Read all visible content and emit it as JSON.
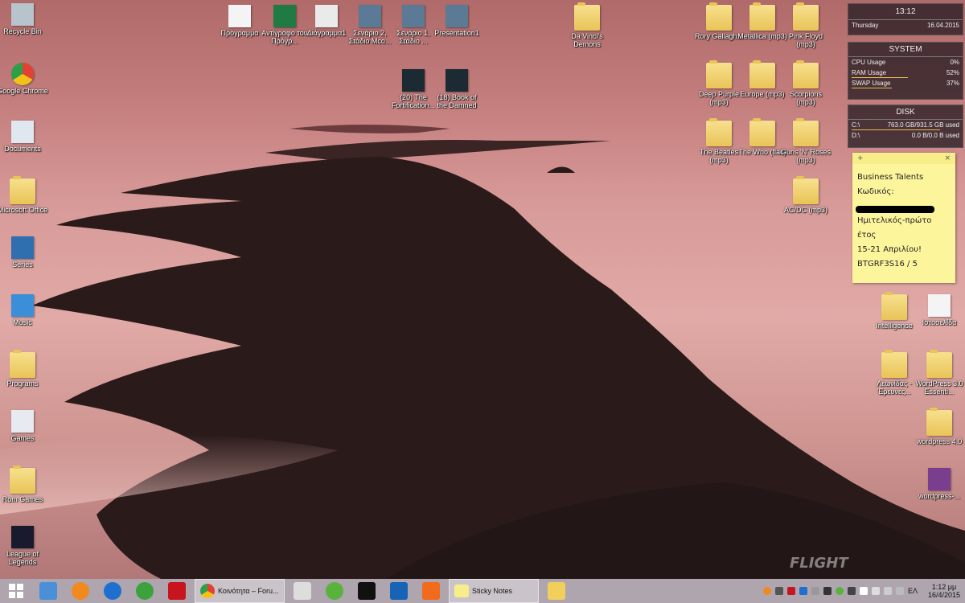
{
  "desktop": {
    "left_column": [
      {
        "label": "Recycle Bin",
        "icon": "recycle-bin-icon"
      },
      {
        "label": "Google Chrome",
        "icon": "chrome-icon"
      },
      {
        "label": "Documents",
        "icon": "documents-icon"
      },
      {
        "label": "Microsoft Office",
        "icon": "folder-icon"
      },
      {
        "label": "Series",
        "icon": "series-icon"
      },
      {
        "label": "Music",
        "icon": "music-icon"
      },
      {
        "label": "Programs",
        "icon": "folder-icon"
      },
      {
        "label": "Games",
        "icon": "games-icon"
      },
      {
        "label": "Rom Games",
        "icon": "folder-icon"
      },
      {
        "label": "League of Legends",
        "icon": "league-icon"
      }
    ],
    "top_row": [
      {
        "label": "Πρόγραμμα",
        "icon": "pdf-icon"
      },
      {
        "label": "Αντίγραφο του Πρόγρ...",
        "icon": "excel-icon"
      },
      {
        "label": "Διάγραμμα1",
        "icon": "diagram-icon"
      },
      {
        "label": "Σενάριο 2, Στάδιο Mco...",
        "icon": "powerpoint-icon"
      },
      {
        "label": "Σενάριο 1, Στάδιο ...",
        "icon": "powerpoint-icon"
      },
      {
        "label": "Presentation1",
        "icon": "powerpoint-icon"
      },
      {
        "label": "(20) The Fortification...",
        "icon": "video-icon"
      },
      {
        "label": "(18) Book of the Damned",
        "icon": "video-icon"
      },
      {
        "label": "Da Vinci's Demons",
        "icon": "folder-icon"
      }
    ],
    "right_icons": [
      {
        "label": "Rory Gallagh...",
        "icon": "folder-icon"
      },
      {
        "label": "Metallica (mp3)",
        "icon": "folder-icon"
      },
      {
        "label": "Pink Floyd (mp3)",
        "icon": "folder-icon"
      },
      {
        "label": "Deep Purple (mp3)",
        "icon": "folder-icon"
      },
      {
        "label": "Europe (mp3)",
        "icon": "folder-icon"
      },
      {
        "label": "Scorpions (mp3)",
        "icon": "folder-icon"
      },
      {
        "label": "The Beatles (mp3)",
        "icon": "folder-icon"
      },
      {
        "label": "The Who (flac)",
        "icon": "folder-icon"
      },
      {
        "label": "Guns 'N' Roses (mp3)",
        "icon": "folder-icon"
      },
      {
        "label": "AC/DC (mp3)",
        "icon": "folder-icon"
      },
      {
        "label": "Intelligence",
        "icon": "folder-icon"
      },
      {
        "label": "Ιστοσελίδα",
        "icon": "document-icon"
      },
      {
        "label": "Λεωνίδας - Έρευνες...",
        "icon": "folder-icon"
      },
      {
        "label": "WordPress 3.0 Essenti...",
        "icon": "folder-icon"
      },
      {
        "label": "wordpress 4.0",
        "icon": "folder-icon"
      },
      {
        "label": "wordpress-...",
        "icon": "winrar-icon"
      }
    ]
  },
  "gadgets": {
    "clock": {
      "time": "13:12",
      "day": "Thursday",
      "date": "16.04.2015"
    },
    "system": {
      "title": "SYSTEM",
      "rows": [
        {
          "label": "CPU Usage",
          "value": "0%",
          "fraction": 0.0
        },
        {
          "label": "RAM Usage",
          "value": "52%",
          "fraction": 0.52
        },
        {
          "label": "SWAP Usage",
          "value": "37%",
          "fraction": 0.37
        }
      ]
    },
    "disk": {
      "title": "DISK",
      "rows": [
        {
          "label": "C:\\",
          "value": "763.0 GB/931.5 GB used",
          "fraction": 0.82
        },
        {
          "label": "D:\\",
          "value": "0.0 B/0.0 B used",
          "fraction": 0.0
        }
      ]
    }
  },
  "sticky_note": {
    "plus": "+",
    "close": "×",
    "text": "Business Talents\nΚωδικός:\n\nΗμιτελικός-πρώτο\nέτος\n15-21 Απριλίου!\nBTGRF3S16 / 5"
  },
  "watermark": "FLIGHT",
  "taskbar": {
    "chrome_window": "Κοινότητα – Foru...",
    "sticky_window": "Sticky Notes",
    "lang": "ΕΛ",
    "time": "1:12 μμ",
    "date": "16/4/2015"
  },
  "colors": {
    "accent": "#e9b94e",
    "sky": "#c47e7e",
    "note": "#fdf59c"
  }
}
